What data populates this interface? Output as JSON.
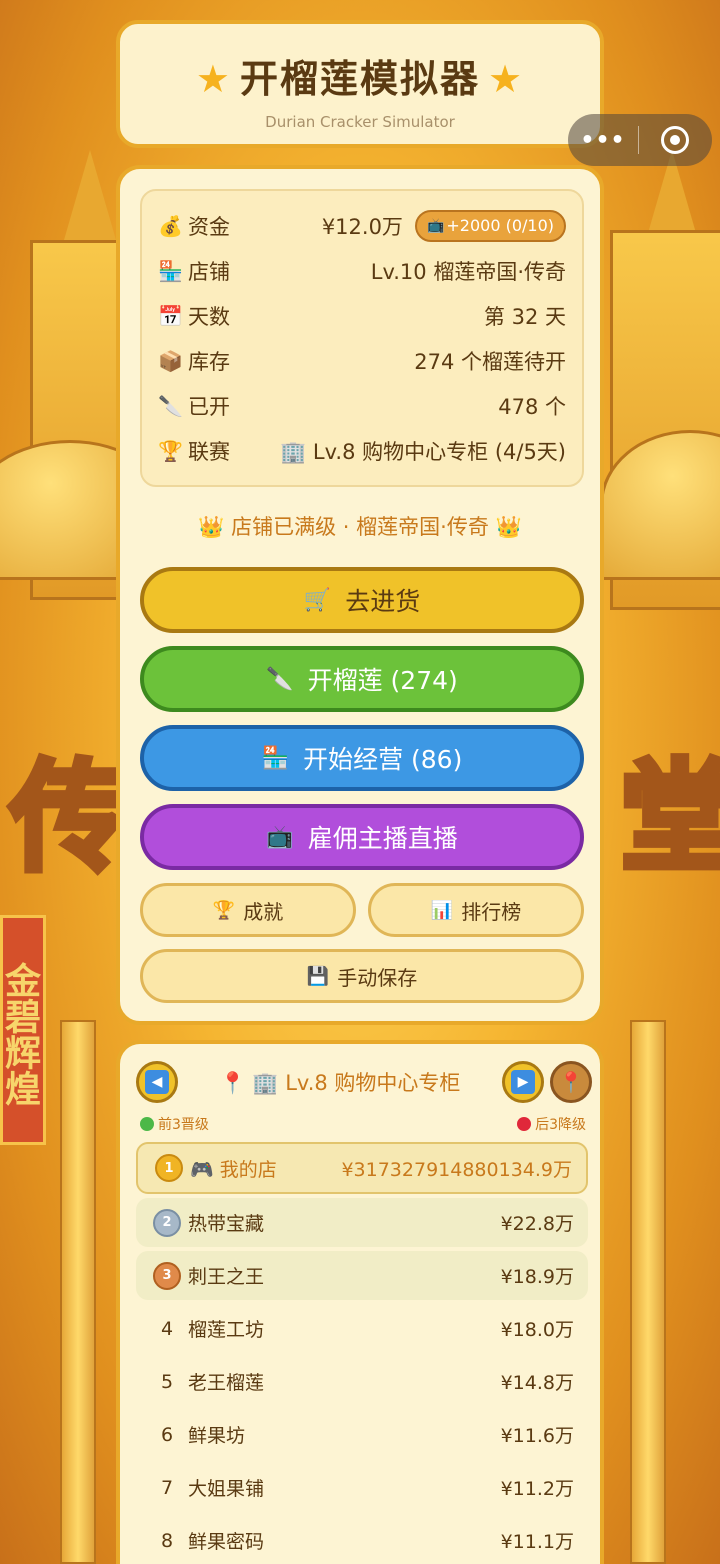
{
  "app": {
    "title": "开榴莲模拟器",
    "subtitle": "Durian Cracker Simulator",
    "star_icon": "star-icon"
  },
  "capsule": {
    "more_label": "•••",
    "more_icon": "more-dots-icon",
    "close_icon": "close-circle-icon"
  },
  "stats": [
    {
      "icon": "💰",
      "icon_name": "money-bag-icon",
      "label": "资金",
      "value": "¥12.0万"
    },
    {
      "icon": "🏪",
      "icon_name": "store-icon",
      "label": "店铺",
      "value": "Lv.10 榴莲帝国·传奇"
    },
    {
      "icon": "📅",
      "icon_name": "calendar-icon",
      "label": "天数",
      "value": "第 32 天"
    },
    {
      "icon": "📦",
      "icon_name": "box-icon",
      "label": "库存",
      "value": "274 个榴莲待开"
    },
    {
      "icon": "🔪",
      "icon_name": "knife-icon",
      "label": "已开",
      "value": "478 个"
    },
    {
      "icon": "🏆",
      "icon_name": "trophy-icon",
      "label": "联赛",
      "value": "🏢 Lv.8 购物中心专柜 (4/5天)"
    }
  ],
  "ad_reward": {
    "icon": "📺",
    "label": "+2000 (0/10)"
  },
  "maxed_text": "👑 店铺已满级 · 榴莲帝国·传奇 👑",
  "buttons": {
    "stock": {
      "icon": "🛒",
      "label": "去进货"
    },
    "open": {
      "icon": "🔪",
      "label": "开榴莲 (274)"
    },
    "run": {
      "icon": "🏪",
      "label": "开始经营 (86)"
    },
    "live": {
      "icon": "📺",
      "label": "雇佣主播直播"
    },
    "achievements": {
      "icon": "🏆",
      "label": "成就"
    },
    "leaderboard": {
      "icon": "📊",
      "label": "排行榜"
    },
    "save": {
      "icon": "💾",
      "label": "手动保存"
    }
  },
  "league": {
    "title": "📍 🏢 Lv.8 购物中心专柜",
    "promote_label": "前3晋级",
    "demote_label": "后3降级",
    "prev_icon": "◀",
    "next_icon": "▶",
    "pin_icon": "📍",
    "colors": {
      "promote": "#4cb848",
      "demote": "#e0283a"
    },
    "rows": [
      {
        "rank": "1",
        "medal": true,
        "name": "🎮 我的店",
        "value": "¥317327914880134.9万",
        "mine": true
      },
      {
        "rank": "2",
        "medal": true,
        "name": "热带宝藏",
        "value": "¥22.8万"
      },
      {
        "rank": "3",
        "medal": true,
        "name": "刺王之王",
        "value": "¥18.9万"
      },
      {
        "rank": "4",
        "name": "榴莲工坊",
        "value": "¥18.0万"
      },
      {
        "rank": "5",
        "name": "老王榴莲",
        "value": "¥14.8万"
      },
      {
        "rank": "6",
        "name": "鲜果坊",
        "value": "¥11.6万"
      },
      {
        "rank": "7",
        "name": "大姐果铺",
        "value": "¥11.2万"
      },
      {
        "rank": "8",
        "name": "鲜果密码",
        "value": "¥11.1万"
      }
    ]
  }
}
